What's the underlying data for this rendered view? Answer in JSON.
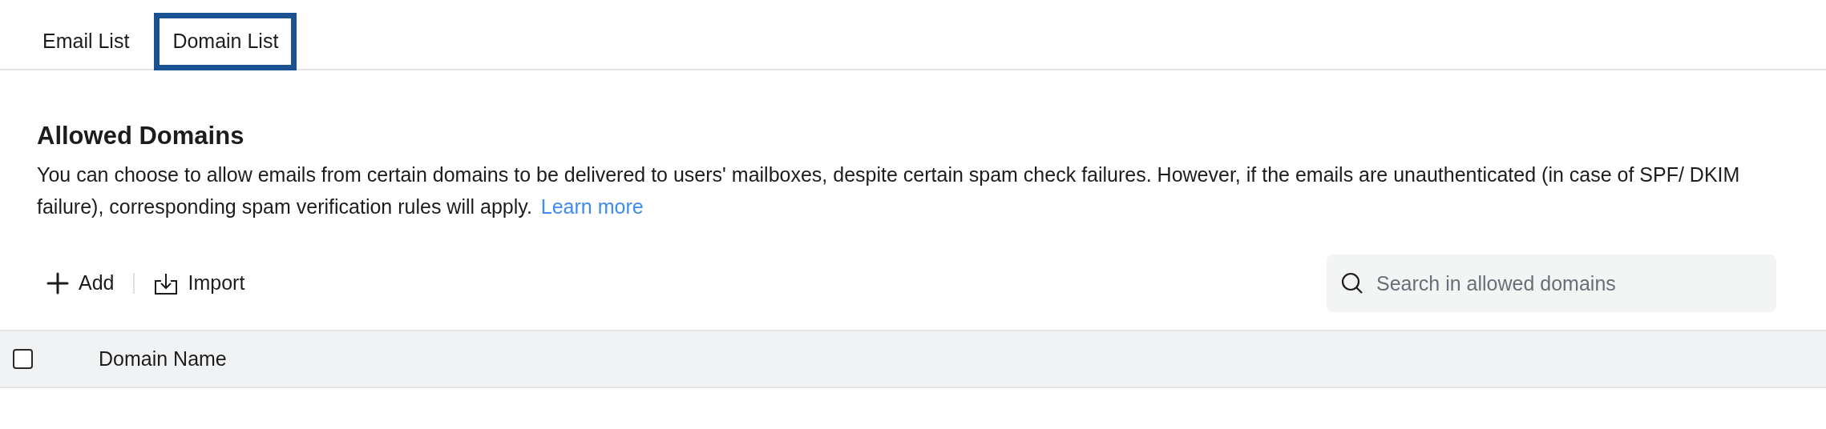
{
  "tabs": [
    {
      "label": "Email List",
      "selected": false
    },
    {
      "label": "Domain List",
      "selected": true
    }
  ],
  "section": {
    "title": "Allowed Domains",
    "description": "You can choose to allow emails from certain domains to be delivered to users' mailboxes, despite certain spam check failures. However, if the emails are unauthenticated (in case of SPF/ DKIM failure), corresponding spam verification rules will apply.",
    "link": "Learn more"
  },
  "toolbar": {
    "add": "Add",
    "import": "Import"
  },
  "search": {
    "placeholder": "Search in allowed domains"
  },
  "table": {
    "select_all_checked": false,
    "columns": [
      "Domain Name"
    ]
  }
}
